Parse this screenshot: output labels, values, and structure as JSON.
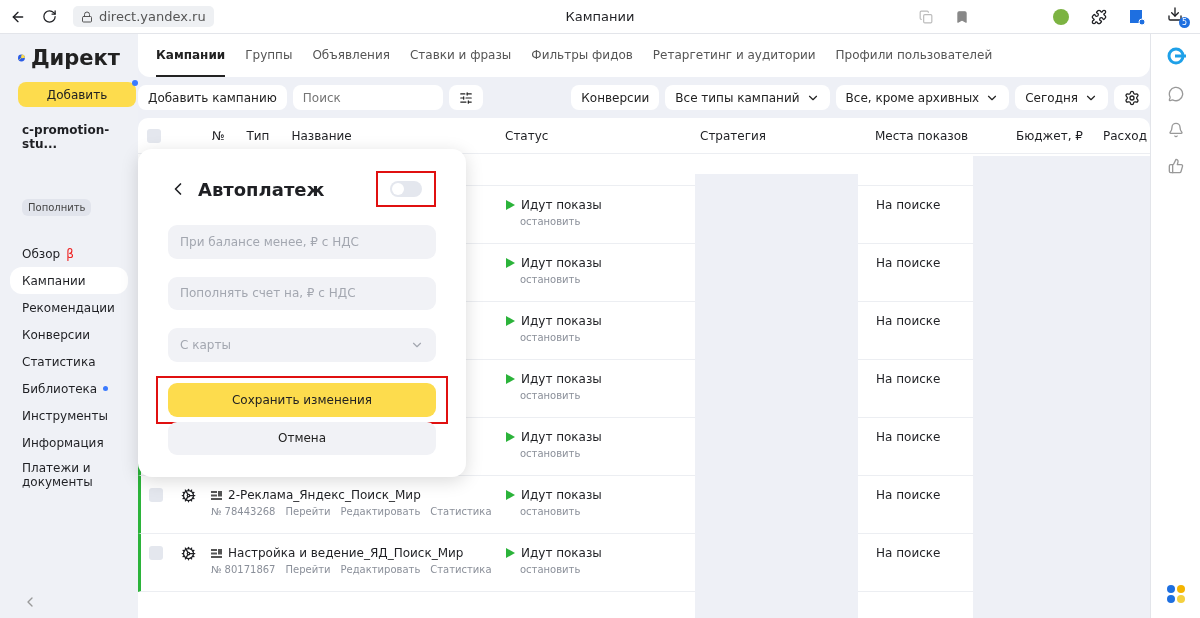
{
  "browser": {
    "url": "direct.yandex.ru",
    "title": "Кампании",
    "download_count": "5"
  },
  "sidebar": {
    "logo": "Директ",
    "add_button": "Добавить",
    "account": "c-promotion-stu...",
    "topup": "Пополнить",
    "items": [
      {
        "label": "Обзор",
        "selected": false,
        "beta": "β",
        "dot": false
      },
      {
        "label": "Кампании",
        "selected": true,
        "dot": false
      },
      {
        "label": "Рекомендации",
        "selected": false,
        "dot": false
      },
      {
        "label": "Конверсии",
        "selected": false,
        "dot": false
      },
      {
        "label": "Статистика",
        "selected": false,
        "dot": false
      },
      {
        "label": "Библиотека",
        "selected": false,
        "dot": true
      },
      {
        "label": "Инструменты",
        "selected": false,
        "dot": false
      },
      {
        "label": "Информация",
        "selected": false,
        "dot": false
      },
      {
        "label": "Платежи и документы",
        "selected": false,
        "dot": false
      }
    ]
  },
  "tabs": [
    {
      "label": "Кампании",
      "selected": true
    },
    {
      "label": "Группы",
      "selected": false
    },
    {
      "label": "Объявления",
      "selected": false
    },
    {
      "label": "Ставки и фразы",
      "selected": false
    },
    {
      "label": "Фильтры фидов",
      "selected": false
    },
    {
      "label": "Ретаргетинг и аудитории",
      "selected": false
    },
    {
      "label": "Профили пользователей",
      "selected": false
    }
  ],
  "toolbar": {
    "add_campaign": "Добавить кампанию",
    "search": {
      "placeholder": "Поиск"
    },
    "filters": [
      {
        "label": "Конверсии",
        "dropdown": false
      },
      {
        "label": "Все типы кампаний",
        "dropdown": true
      },
      {
        "label": "Все, кроме архивных",
        "dropdown": true
      },
      {
        "label": "Сегодня",
        "dropdown": true
      }
    ]
  },
  "table": {
    "columns": [
      "№",
      "Тип",
      "Название",
      "Статус",
      "Стратегия",
      "Места показов",
      "Бюджет, ₽",
      "Расход"
    ],
    "select_all_checked": false,
    "rows": [
      {
        "status": "Идут показы",
        "action": "остановить",
        "placement": "На поиске"
      },
      {
        "status": "Идут показы",
        "action": "остановить",
        "placement": "На поиске"
      },
      {
        "status": "Идут показы",
        "action": "остановить",
        "placement": "На поиске"
      },
      {
        "status": "Идут показы",
        "action": "остановить",
        "placement": "На поиске"
      },
      {
        "status": "Идут показы",
        "action": "остановить",
        "placement": "На поиске"
      },
      {
        "name": "2-Реклама_Яндекс_Поиск_Мир",
        "checked": false,
        "number": "№ 78443268",
        "links": [
          "Перейти",
          "Редактировать",
          "Статистика"
        ],
        "status": "Идут показы",
        "action": "остановить",
        "placement": "На поиске"
      },
      {
        "name": "Настройка и ведение_ЯД_Поиск_Мир",
        "checked": false,
        "number": "№ 80171867",
        "links": [
          "Перейти",
          "Редактировать",
          "Статистика"
        ],
        "status": "Идут показы",
        "action": "остановить",
        "placement": "На поиске"
      }
    ]
  },
  "popup": {
    "title": "Автоплатеж",
    "enabled": false,
    "toggle_highlighted": true,
    "fields": [
      {
        "kind": "input",
        "placeholder": "При балансе менее, ₽ с НДС"
      },
      {
        "kind": "input",
        "placeholder": "Пополнять счет на, ₽ с НДС"
      },
      {
        "kind": "select",
        "placeholder": "С карты"
      }
    ],
    "save": {
      "label": "Сохранить изменения",
      "highlighted": true
    },
    "cancel": "Отмена"
  }
}
